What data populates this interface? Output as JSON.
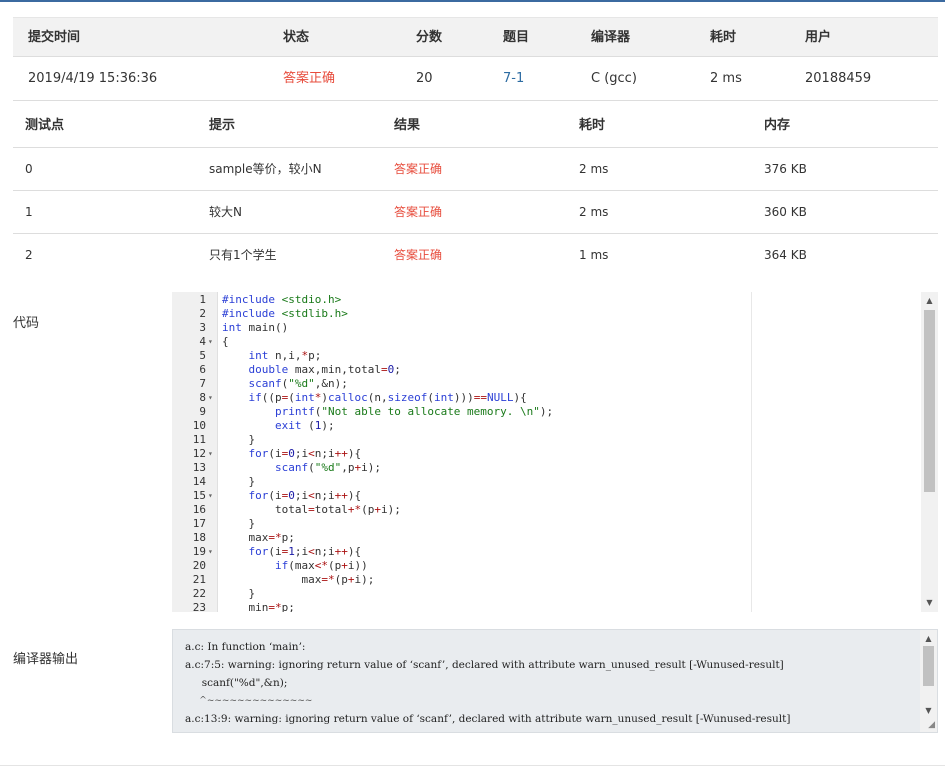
{
  "submission": {
    "headers": [
      "提交时间",
      "状态",
      "分数",
      "题目",
      "编译器",
      "耗时",
      "用户"
    ],
    "row": {
      "time": "2019/4/19 15:36:36",
      "status": "答案正确",
      "score": "20",
      "problem": "7-1",
      "compiler": "C (gcc)",
      "duration": "2 ms",
      "user": "20188459"
    }
  },
  "tests": {
    "headers": [
      "测试点",
      "提示",
      "结果",
      "耗时",
      "内存"
    ],
    "rows": [
      {
        "id": "0",
        "hint": "sample等价，较小N",
        "result": "答案正确",
        "time": "2 ms",
        "memory": "376 KB"
      },
      {
        "id": "1",
        "hint": "较大N",
        "result": "答案正确",
        "time": "2 ms",
        "memory": "360 KB"
      },
      {
        "id": "2",
        "hint": "只有1个学生",
        "result": "答案正确",
        "time": "1 ms",
        "memory": "364 KB"
      }
    ]
  },
  "code_label": "代码",
  "compiler_output_label": "编译器输出",
  "code_lines": [
    {
      "n": "1",
      "fold": "",
      "text": "#include <stdio.h>"
    },
    {
      "n": "2",
      "fold": "",
      "text": "#include <stdlib.h>"
    },
    {
      "n": "3",
      "fold": "",
      "text": "int main()"
    },
    {
      "n": "4",
      "fold": "▾",
      "text": "{"
    },
    {
      "n": "5",
      "fold": "",
      "text": "    int n,i,*p;"
    },
    {
      "n": "6",
      "fold": "",
      "text": "    double max,min,total=0;"
    },
    {
      "n": "7",
      "fold": "",
      "text": "    scanf(\"%d\",&n);"
    },
    {
      "n": "8",
      "fold": "▾",
      "text": "    if((p=(int*)calloc(n,sizeof(int)))==NULL){"
    },
    {
      "n": "9",
      "fold": "",
      "text": "        printf(\"Not able to allocate memory. \\n\");"
    },
    {
      "n": "10",
      "fold": "",
      "text": "        exit (1);"
    },
    {
      "n": "11",
      "fold": "",
      "text": "    }"
    },
    {
      "n": "12",
      "fold": "▾",
      "text": "    for(i=0;i<n;i++){"
    },
    {
      "n": "13",
      "fold": "",
      "text": "        scanf(\"%d\",p+i);"
    },
    {
      "n": "14",
      "fold": "",
      "text": "    }"
    },
    {
      "n": "15",
      "fold": "▾",
      "text": "    for(i=0;i<n;i++){"
    },
    {
      "n": "16",
      "fold": "",
      "text": "        total=total+*(p+i);"
    },
    {
      "n": "17",
      "fold": "",
      "text": "    }"
    },
    {
      "n": "18",
      "fold": "",
      "text": "    max=*p;"
    },
    {
      "n": "19",
      "fold": "▾",
      "text": "    for(i=1;i<n;i++){"
    },
    {
      "n": "20",
      "fold": "",
      "text": "        if(max<*(p+i))"
    },
    {
      "n": "21",
      "fold": "",
      "text": "            max=*(p+i);"
    },
    {
      "n": "22",
      "fold": "",
      "text": "    }"
    },
    {
      "n": "23",
      "fold": "",
      "text": "    min=*p;"
    }
  ],
  "compiler_output": [
    "a.c: In function ‘main’:",
    "a.c:7:5: warning: ignoring return value of ‘scanf’, declared with attribute warn_unused_result [-Wunused-result]",
    "     scanf(\"%d\",&n);",
    "     ^~~~~~~~~~~~~~~",
    "a.c:13:9: warning: ignoring return value of ‘scanf’, declared with attribute warn_unused_result [-Wunused-result]"
  ],
  "colors": {
    "accepted": "#e74c3c",
    "link": "#2d6ca2",
    "topbar": "#3b6aa0"
  },
  "icons": {
    "scroll_up": "chevron-up-icon",
    "scroll_down": "chevron-down-icon",
    "resize": "resize-grip-icon"
  }
}
